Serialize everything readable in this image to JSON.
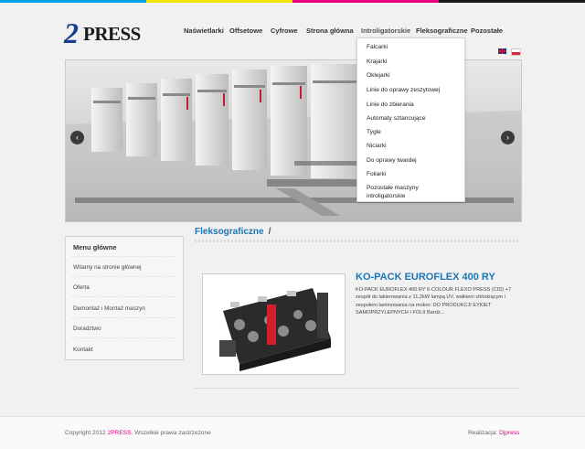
{
  "brand": {
    "logo_prefix": "2",
    "logo_text": "PRESS",
    "logo_color": "#1a3f8f"
  },
  "top_stripe_colors": [
    "#00a0e9",
    "#f4e400",
    "#e4007c",
    "#1a1a1a"
  ],
  "nav": {
    "items": [
      {
        "label": "Naświetlarki"
      },
      {
        "label": "Offsetowe"
      },
      {
        "label": "Cyfrowe"
      },
      {
        "label": "Strona główna"
      },
      {
        "label": "Introligatorskie"
      },
      {
        "label": "Fleksograficzne"
      },
      {
        "label": "Pozostałe"
      }
    ],
    "active_index": 4
  },
  "dropdown": {
    "items": [
      "Falcarki",
      "Krajarki",
      "Oklejarki",
      "Linie do oprawy zeszytowej",
      "Linie do zbierania",
      "Automaty sztancujące",
      "Tygle",
      "Niciarki",
      "Do oprawy twardej",
      "Foliarki",
      "Pozostałe maszyny introligatorskie"
    ]
  },
  "languages": [
    {
      "code": "en",
      "icon": "uk-flag-icon"
    },
    {
      "code": "pl",
      "icon": "pl-flag-icon"
    }
  ],
  "slider": {
    "prev_icon": "‹",
    "next_icon": "›"
  },
  "breadcrumb": {
    "current": "Fleksograficzne",
    "separator": "/"
  },
  "sidebar": {
    "title": "Menu główne",
    "items": [
      "Witamy na stronie głównej",
      "Oferta",
      "Demontaż i Montaż maszyn",
      "Doradztwo",
      "Kontakt"
    ]
  },
  "product": {
    "title": "KO-PACK EUROFLEX 400 RY",
    "description": "KO-PACK EUROFLEX 400 RY 6-COLOUR FLEXO PRESS (CID) +7 zespół do lakierowania z 11,2kW lampą UV, walkiem chłodzącym i zespołem laminowania na mokro:    DO PRODUKCJI EYKIET SAMOPRZYLEPNYCH I FOLII  Bardz..."
  },
  "footer": {
    "copyright_prefix": "Copyright 2012 ",
    "copyright_brand": "2PRESS",
    "copyright_suffix": ". Wszelkie prawa zastrzeżone",
    "credit_label": "Realizacja: ",
    "credit_link": "Djpress",
    "accent_color": "#e4007c"
  },
  "link_color": "#1b76b3"
}
